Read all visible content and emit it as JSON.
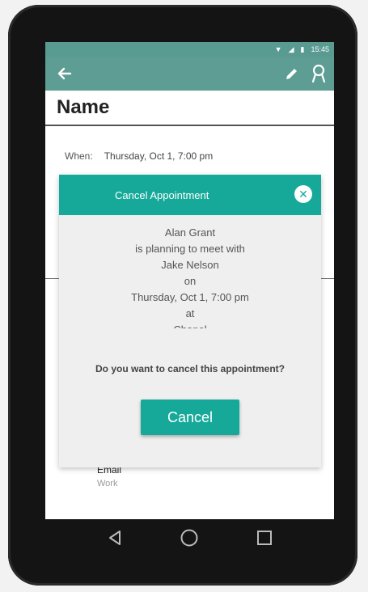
{
  "status_bar": {
    "time": "15:45",
    "icons": [
      "wifi-icon",
      "signal-icon",
      "battery-icon"
    ]
  },
  "app_bar": {
    "left_icon": "back-arrow-icon",
    "right_icons": [
      "edit-pencil-icon",
      "person-pin-icon"
    ]
  },
  "page": {
    "title": "Name",
    "when_label": "When:",
    "when_value": "Thursday, Oct 1, 7:00 pm",
    "email_label": "Email",
    "email_sub": "Work"
  },
  "dialog": {
    "title": "Cancel Appointment",
    "close_icon": "close-circle-icon",
    "message_lines": [
      "Alan Grant",
      "is planning to meet with",
      "Jake Nelson",
      "on",
      "Thursday, Oct 1, 7:00 pm",
      "at",
      "Chapel"
    ],
    "question": "Do you want to cancel this appointment?",
    "cancel_label": "Cancel"
  },
  "colors": {
    "app_bar": "#5d9d93",
    "accent": "#16a99a",
    "dialog_bg": "#efefef"
  },
  "nav_bar": {
    "icons": [
      "back-triangle-icon",
      "home-circle-icon",
      "recents-square-icon"
    ]
  }
}
